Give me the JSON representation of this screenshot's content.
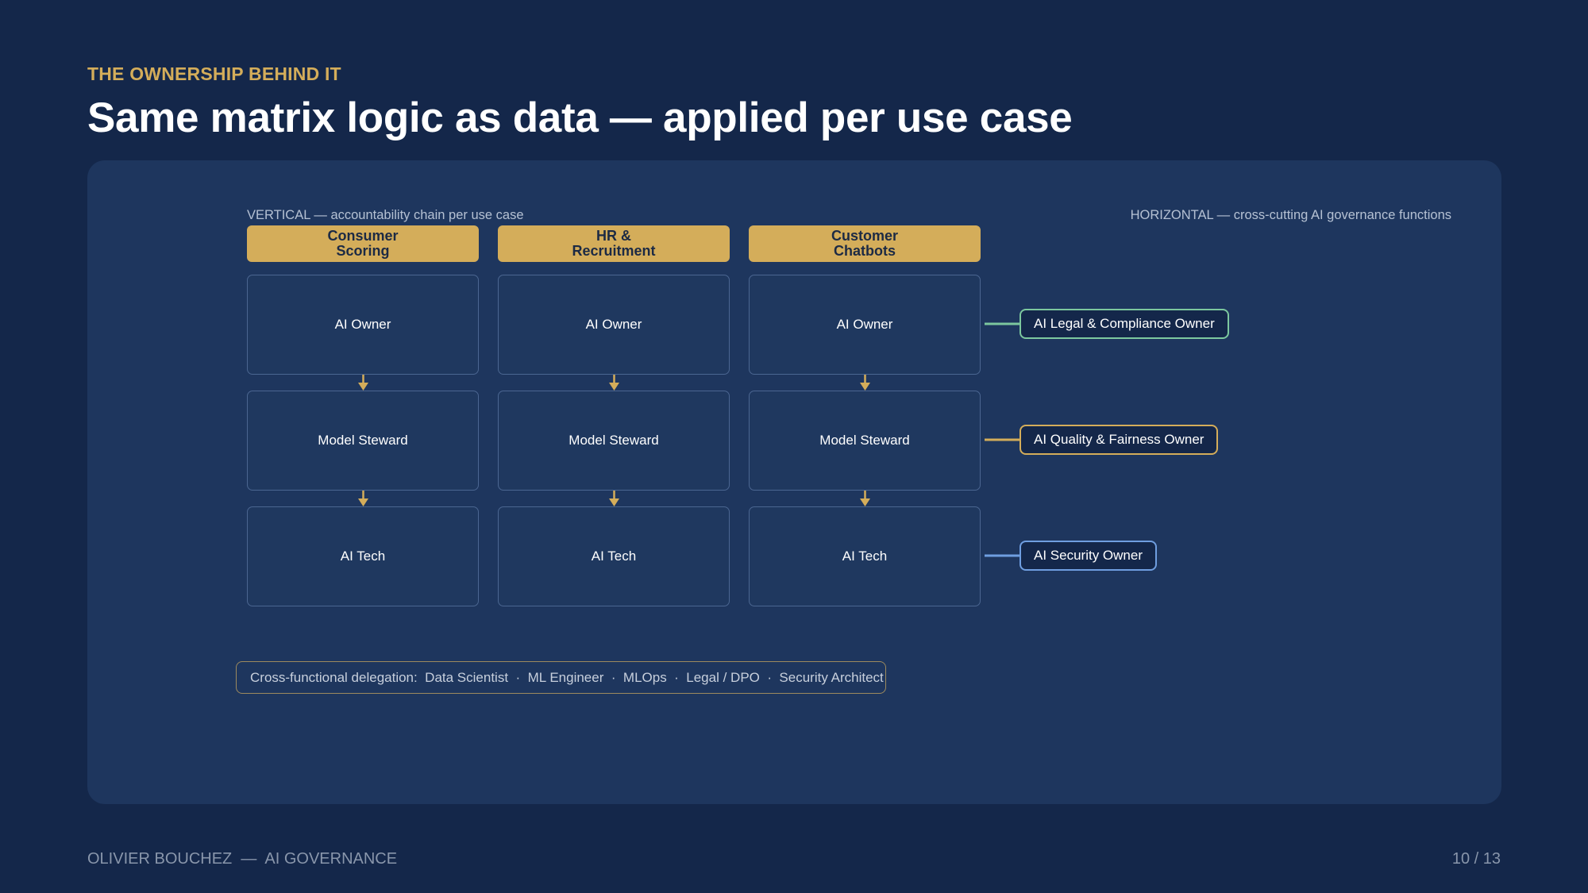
{
  "header": {
    "eyebrow": "THE OWNERSHIP BEHIND IT",
    "title": "Same matrix logic as data — applied per use case"
  },
  "matrix": {
    "vertical_label": "VERTICAL — accountability chain per use case",
    "horizontal_label": "HORIZONTAL — cross-cutting AI governance functions",
    "use_cases": [
      {
        "label": "Consumer\nScoring",
        "roles": [
          "AI Owner",
          "Model Steward",
          "AI Tech"
        ]
      },
      {
        "label": "HR &\nRecruitment",
        "roles": [
          "AI Owner",
          "Model Steward",
          "AI Tech"
        ]
      },
      {
        "label": "Customer\nChatbots",
        "roles": [
          "AI Owner",
          "Model Steward",
          "AI Tech"
        ]
      }
    ],
    "horizontal_functions": [
      {
        "label": "AI Legal & Compliance Owner",
        "color": "#7cc79e"
      },
      {
        "label": "AI Quality & Fairness Owner",
        "color": "#d4ad5a"
      },
      {
        "label": "AI Security Owner",
        "color": "#6f9ee0"
      }
    ],
    "arrow_color": "#d4ad5a"
  },
  "delegation": {
    "text": "Cross-functional delegation:  Data Scientist  ·  ML Engineer  ·  MLOps  ·  Legal / DPO  ·  Security Architect"
  },
  "footer": {
    "left": "OLIVIER BOUCHEZ  —  AI GOVERNANCE",
    "page": "10 / 13"
  }
}
